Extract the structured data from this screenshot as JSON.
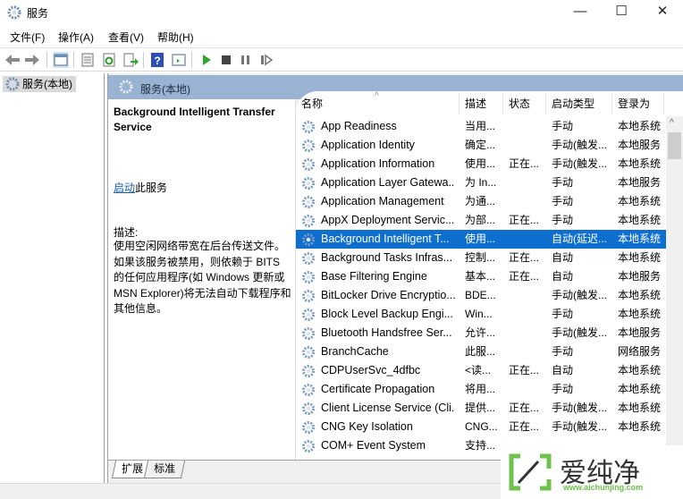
{
  "window": {
    "title": "服务",
    "minimize": "—",
    "maximize": "☐",
    "close": "✕"
  },
  "menu": [
    "文件(F)",
    "操作(A)",
    "查看(V)",
    "帮助(H)"
  ],
  "toolbar": [
    "back-icon",
    "forward-icon",
    "show-tree-icon",
    "properties-icon",
    "refresh-icon",
    "export-icon",
    "help-icon",
    "console-icon",
    "start-icon",
    "stop-icon",
    "pause-icon",
    "resume-icon"
  ],
  "tree": {
    "item": "服务(本地)"
  },
  "panel": {
    "header": "服务(本地)"
  },
  "details": {
    "title": "Background Intelligent Transfer Service",
    "action_link": "启动",
    "action_rest": "此服务",
    "desc_label": "描述:",
    "desc_text": "使用空闲网络带宽在后台传送文件。如果该服务被禁用，则依赖于 BITS 的任何应用程序(如 Windows 更新或 MSN Explorer)将无法自动下载程序和其他信息。"
  },
  "columns": [
    "名称",
    "描述",
    "状态",
    "启动类型",
    "登录为"
  ],
  "services": [
    [
      "App Readiness",
      "当用...",
      "",
      "手动",
      "本地系统"
    ],
    [
      "Application Identity",
      "确定...",
      "",
      "手动(触发...",
      "本地服务"
    ],
    [
      "Application Information",
      "使用...",
      "正在...",
      "手动(触发...",
      "本地系统"
    ],
    [
      "Application Layer Gatewa...",
      "为 In...",
      "",
      "手动",
      "本地服务"
    ],
    [
      "Application Management",
      "为通...",
      "",
      "手动",
      "本地系统"
    ],
    [
      "AppX Deployment Servic...",
      "为部...",
      "正在...",
      "手动",
      "本地系统"
    ],
    [
      "Background Intelligent T...",
      "使用...",
      "",
      "自动(延迟...",
      "本地系统"
    ],
    [
      "Background Tasks Infras...",
      "控制...",
      "正在...",
      "自动",
      "本地系统"
    ],
    [
      "Base Filtering Engine",
      "基本...",
      "正在...",
      "自动",
      "本地服务"
    ],
    [
      "BitLocker Drive Encryptio...",
      "BDE...",
      "",
      "手动(触发...",
      "本地系统"
    ],
    [
      "Block Level Backup Engi...",
      "Win...",
      "",
      "手动",
      "本地系统"
    ],
    [
      "Bluetooth Handsfree Ser...",
      "允许...",
      "",
      "手动(触发...",
      "本地服务"
    ],
    [
      "BranchCache",
      "此服...",
      "",
      "手动",
      "网络服务"
    ],
    [
      "CDPUserSvc_4dfbc",
      "<读...",
      "正在...",
      "自动",
      "本地系统"
    ],
    [
      "Certificate Propagation",
      "将用...",
      "",
      "手动",
      "本地系统"
    ],
    [
      "Client License Service (Cli...",
      "提供...",
      "正在...",
      "手动(触发...",
      "本地系统"
    ],
    [
      "CNG Key Isolation",
      "CNG...",
      "正在...",
      "手动(触发...",
      "本地系统"
    ],
    [
      "COM+ Event System",
      "支持...",
      "",
      "",
      ""
    ]
  ],
  "selected_index": 6,
  "tabs": [
    "扩展",
    "标准"
  ],
  "watermark": {
    "text": "爱纯净",
    "url": "www.aichunjing.com"
  },
  "colors": {
    "selection": "#0f6fce",
    "header": "#9ab3d3",
    "link": "#1a5ea8"
  }
}
